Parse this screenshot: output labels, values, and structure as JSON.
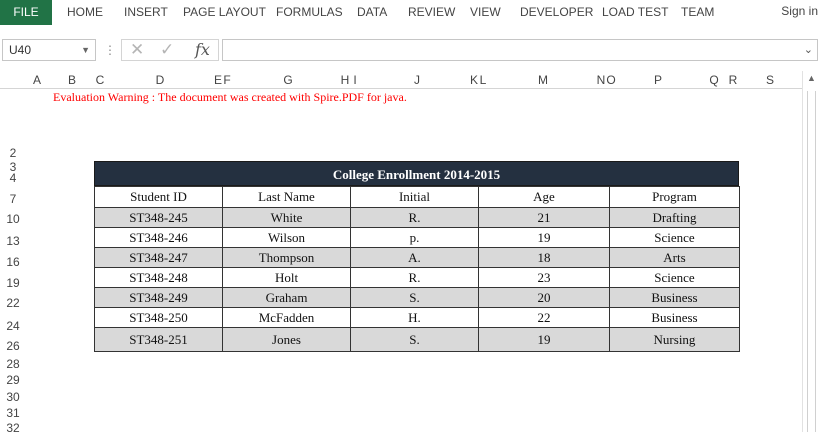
{
  "ribbon": {
    "file": "FILE",
    "tabs": [
      "HOME",
      "INSERT",
      "PAGE LAYOUT",
      "FORMULAS",
      "DATA",
      "REVIEW",
      "VIEW",
      "DEVELOPER",
      "LOAD TEST",
      "TEAM"
    ],
    "sign_in": "Sign in"
  },
  "formula_bar": {
    "name_box": "U40",
    "fx_label": "fx",
    "formula": ""
  },
  "columns": [
    "A",
    "B",
    "C",
    "D",
    "E",
    "F",
    "G",
    "H",
    "I",
    "J",
    "K",
    "L",
    "M",
    "N",
    "O",
    "P",
    "Q",
    "R",
    "S"
  ],
  "rows": [
    "2",
    "3",
    "4",
    "7",
    "10",
    "13",
    "16",
    "19",
    "22",
    "24",
    "26",
    "28",
    "29",
    "30",
    "31",
    "32"
  ],
  "warning": "Evaluation Warning : The document was created with Spire.PDF for java.",
  "table": {
    "title": "College Enrollment 2014-2015",
    "headers": [
      "Student ID",
      "Last Name",
      "Initial",
      "Age",
      "Program"
    ],
    "rows": [
      [
        "ST348-245",
        "White",
        "R.",
        "21",
        "Drafting"
      ],
      [
        "ST348-246",
        "Wilson",
        "p.",
        "19",
        "Science"
      ],
      [
        "ST348-247",
        "Thompson",
        "A.",
        "18",
        "Arts"
      ],
      [
        "ST348-248",
        "Holt",
        "R.",
        "23",
        "Science"
      ],
      [
        "ST348-249",
        "Graham",
        "S.",
        "20",
        "Business"
      ],
      [
        "ST348-250",
        "McFadden",
        "H.",
        "22",
        "Business"
      ],
      [
        "ST348-251",
        "Jones",
        "S.",
        "19",
        "Nursing"
      ]
    ]
  },
  "colors": {
    "file_tab": "#217346",
    "table_title_bg": "#243040",
    "row_shade": "#d9d9d9",
    "warning": "#ff0000"
  }
}
